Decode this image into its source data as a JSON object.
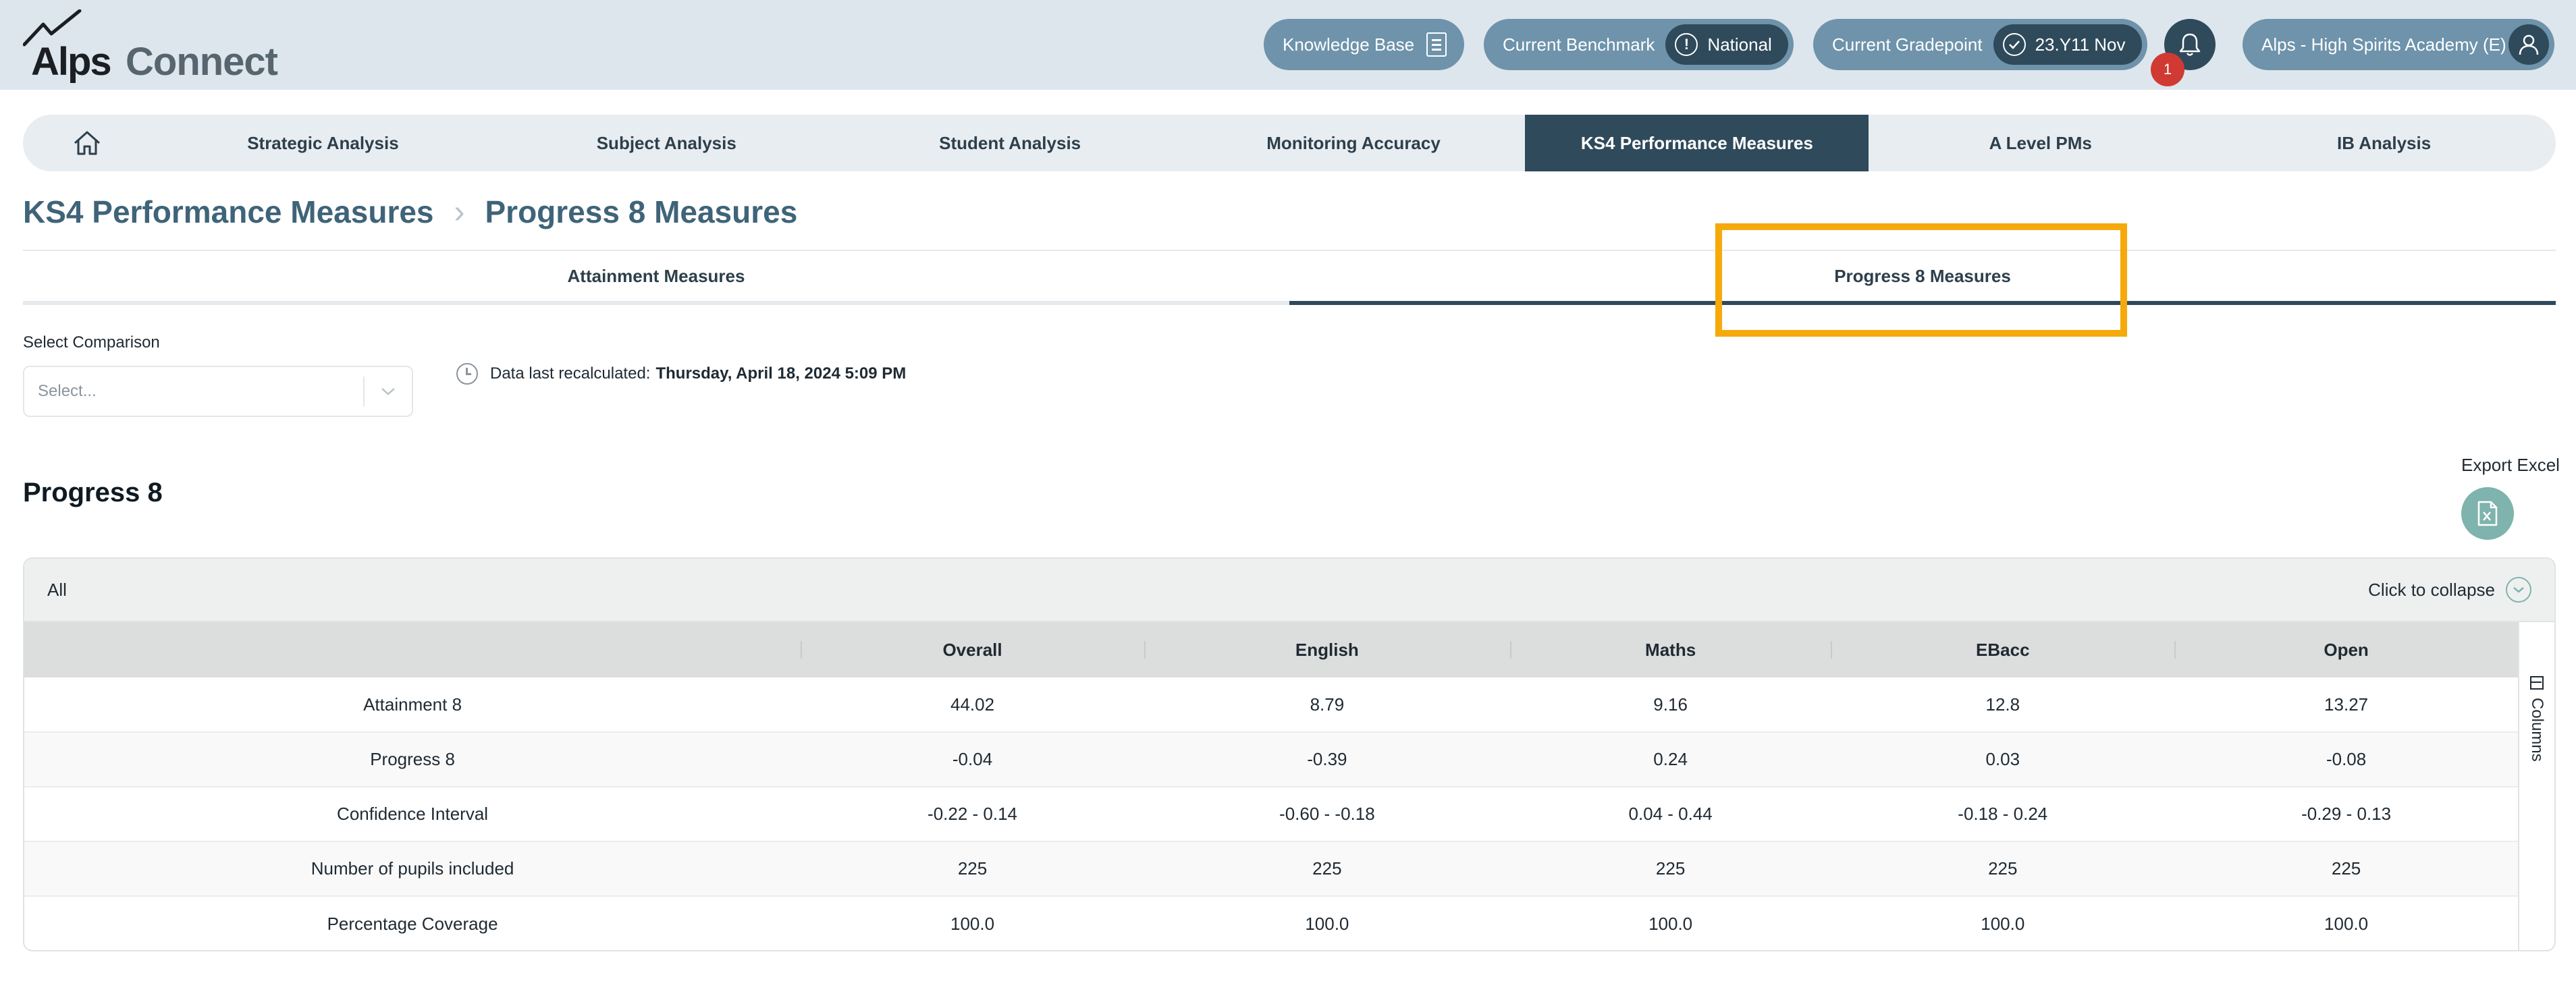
{
  "header": {
    "logo_alps": "Alps",
    "logo_connect": "Connect",
    "knowledge_base": "Knowledge Base",
    "benchmark_label": "Current Benchmark",
    "benchmark_value": "National",
    "gradepoint_label": "Current Gradepoint",
    "gradepoint_value": "23.Y11 Nov",
    "notification_count": "1",
    "school_name": "Alps - High Spirits Academy (E)"
  },
  "nav": {
    "items": [
      "Strategic Analysis",
      "Subject Analysis",
      "Student Analysis",
      "Monitoring Accuracy",
      "KS4 Performance Measures",
      "A Level PMs",
      "IB Analysis"
    ],
    "active_index": 4
  },
  "breadcrumb": {
    "parent": "KS4 Performance Measures",
    "current": "Progress 8 Measures"
  },
  "subtabs": {
    "items": [
      "Attainment Measures",
      "Progress 8 Measures"
    ],
    "active_index": 1
  },
  "filters": {
    "comparison_label": "Select Comparison",
    "comparison_placeholder": "Select...",
    "recalc_prefix": "Data last recalculated:",
    "recalc_value": "Thursday, April 18, 2024 5:09 PM"
  },
  "section": {
    "title": "Progress 8",
    "export_label": "Export Excel"
  },
  "panel": {
    "group": "All",
    "collapse_label": "Click to collapse",
    "columns_label": "Columns"
  },
  "table": {
    "headers": [
      "",
      "Overall",
      "English",
      "Maths",
      "EBacc",
      "Open"
    ],
    "rows": [
      [
        "Attainment 8",
        "44.02",
        "8.79",
        "9.16",
        "12.8",
        "13.27"
      ],
      [
        "Progress 8",
        "-0.04",
        "-0.39",
        "0.24",
        "0.03",
        "-0.08"
      ],
      [
        "Confidence Interval",
        "-0.22 - 0.14",
        "-0.60 - -0.18",
        "0.04 - 0.44",
        "-0.18 - 0.24",
        "-0.29 - 0.13"
      ],
      [
        "Number of pupils included",
        "225",
        "225",
        "225",
        "225",
        "225"
      ],
      [
        "Percentage Coverage",
        "100.0",
        "100.0",
        "100.0",
        "100.0",
        "100.0"
      ]
    ]
  },
  "colors": {
    "header_bg": "#dde6ed",
    "pill": "#6e93ab",
    "dark": "#2f4a5b",
    "highlight": "#f6a90a",
    "badge": "#d03a32",
    "teal": "#7fb3ad"
  },
  "icons": [
    "home-icon",
    "book-icon",
    "alert-icon",
    "check-icon",
    "bell-icon",
    "user-icon",
    "chevron-down-icon",
    "clock-icon",
    "excel-file-icon",
    "chevron-circle-icon",
    "columns-icon"
  ]
}
